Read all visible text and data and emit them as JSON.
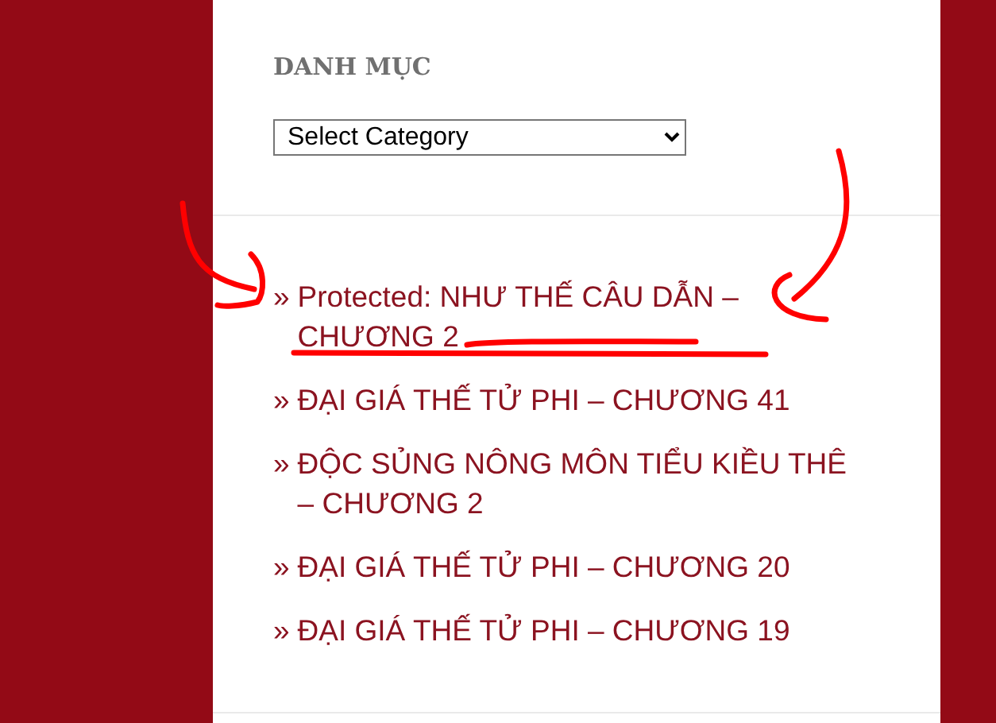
{
  "widget": {
    "heading": "DANH MỤC",
    "select": {
      "value": "Select Category"
    }
  },
  "posts": [
    {
      "marker": "»",
      "title": "Protected: NHƯ THẾ CÂU DẪN – CHƯƠNG 2"
    },
    {
      "marker": "»",
      "title": "ĐẠI GIÁ THẾ TỬ PHI – CHƯƠNG 41"
    },
    {
      "marker": "»",
      "title": "ĐỘC SỦNG NÔNG MÔN TIỂU KIỀU THÊ – CHƯƠNG 2"
    },
    {
      "marker": "»",
      "title": "ĐẠI GIÁ THẾ TỬ PHI – CHƯƠNG 20"
    },
    {
      "marker": "»",
      "title": "ĐẠI GIÁ THẾ TỬ PHI – CHƯƠNG 19"
    }
  ]
}
